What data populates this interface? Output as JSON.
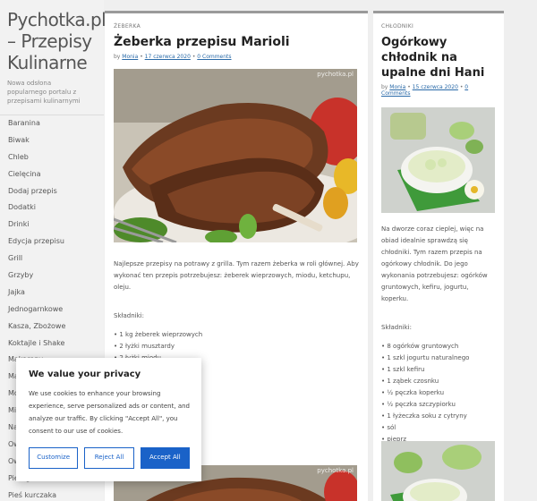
{
  "site": {
    "title": "Pychotka.pl – Przepisy Kulinarne",
    "description": "Nowa odsłona popularnego portalu z przepisami kulinarnymi"
  },
  "categories": [
    "Baranina",
    "Biwak",
    "Chleb",
    "Cielęcina",
    "Dodaj przepis",
    "Dodatki",
    "Drinki",
    "Edycja przepisu",
    "Grill",
    "Grzyby",
    "Jajka",
    "Jednogarnkowe",
    "Kasza, Zbożowe",
    "Koktajle i Shake",
    "Makarony",
    "Ma",
    "Mo",
    "Mi",
    "Na",
    "Ow",
    "Ow",
    "Pierogi",
    "Pieś kurczaka"
  ],
  "main_post": {
    "category": "ŻEBERKA",
    "title": "Żeberka przepisu Marioli",
    "by": "by",
    "author": "Monia",
    "date": "17 czerwca 2020",
    "comments": "0 Comments",
    "intro": "Najlepsze przepisy na potrawy z grilla. Tym razem żeberka w roli głównej. Aby wykonać ten przepis potrzebujesz: żeberek wieprzowych, miodu, ketchupu, oleju.",
    "ingredients_label": "Składniki:",
    "ingredients": [
      "1 kg żeberek wieprzowych",
      "2 łyżki musztardy",
      "2 łyżki miodu"
    ],
    "image_watermark": "pychotka.pl"
  },
  "side_post": {
    "category": "CHŁODNIKI",
    "title": "Ogórkowy chłodnik na upalne dni Hani",
    "by": "by",
    "author": "Monia",
    "date": "15 czerwca 2020",
    "comments": "0 Comments",
    "intro": "Na dworze coraz cieplej, więc na obiad idealnie sprawdzą się chłodniki. Tym razem przepis na ogórkowy chłodnik. Do jego wykonania potrzebujesz: ogórków gruntowych, kefiru, jogurtu, koperku.",
    "ingredients_label": "Składniki:",
    "ingredients": [
      "8 ogórków gruntowych",
      "1 szkl jogurtu naturalnego",
      "1 szkl kefiru",
      "1 ząbek czosnku",
      "½ pęczka koperku",
      "½ pęczka szczypiorku",
      "1 łyżeczka soku z cytryny",
      "sól",
      "pieprz"
    ]
  },
  "cookie": {
    "title": "We value your privacy",
    "text": "We use cookies to enhance your browsing experience, serve personalized ads or content, and analyze our traffic. By clicking \"Accept All\", you consent to our use of cookies.",
    "customize": "Customize",
    "reject": "Reject All",
    "accept": "Accept All"
  }
}
